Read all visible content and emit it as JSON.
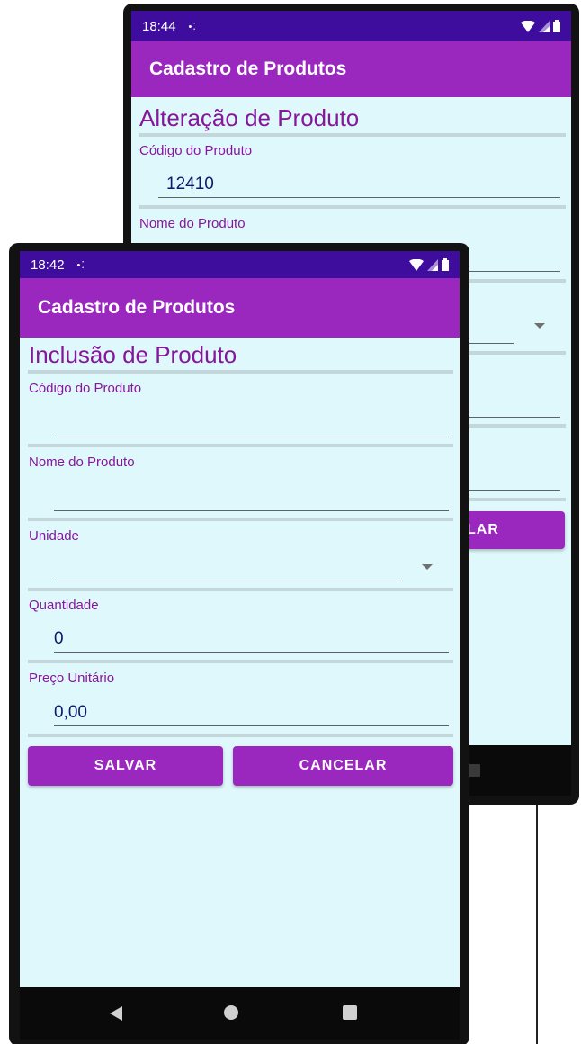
{
  "back_screen": {
    "status_bar": {
      "time": "18:44",
      "notification": "•⁚"
    },
    "app_bar": {
      "title": "Cadastro de Produtos"
    },
    "form": {
      "title": "Alteração de Produto",
      "codigo": {
        "label": "Código do Produto",
        "value": "12410"
      },
      "nome": {
        "label": "Nome do Produto",
        "value": ""
      },
      "cancel_partial_label": "LAR"
    }
  },
  "front_screen": {
    "status_bar": {
      "time": "18:42",
      "notification": "•⁚"
    },
    "app_bar": {
      "title": "Cadastro de Produtos"
    },
    "form": {
      "title": "Inclusão de Produto",
      "codigo": {
        "label": "Código do Produto",
        "value": ""
      },
      "nome": {
        "label": "Nome do Produto",
        "value": ""
      },
      "unidade": {
        "label": "Unidade",
        "value": ""
      },
      "quantidade": {
        "label": "Quantidade",
        "value": "0"
      },
      "preco": {
        "label": "Preço Unitário",
        "value": "0,00"
      },
      "save_label": "SALVAR",
      "cancel_label": "CANCELAR"
    }
  },
  "colors": {
    "status_bar": "#3f0d9e",
    "app_bar": "#9a27be",
    "content_bg": "#dff8fb",
    "label": "#86169c",
    "value": "#0c1a6a",
    "button": "#9a27be"
  }
}
